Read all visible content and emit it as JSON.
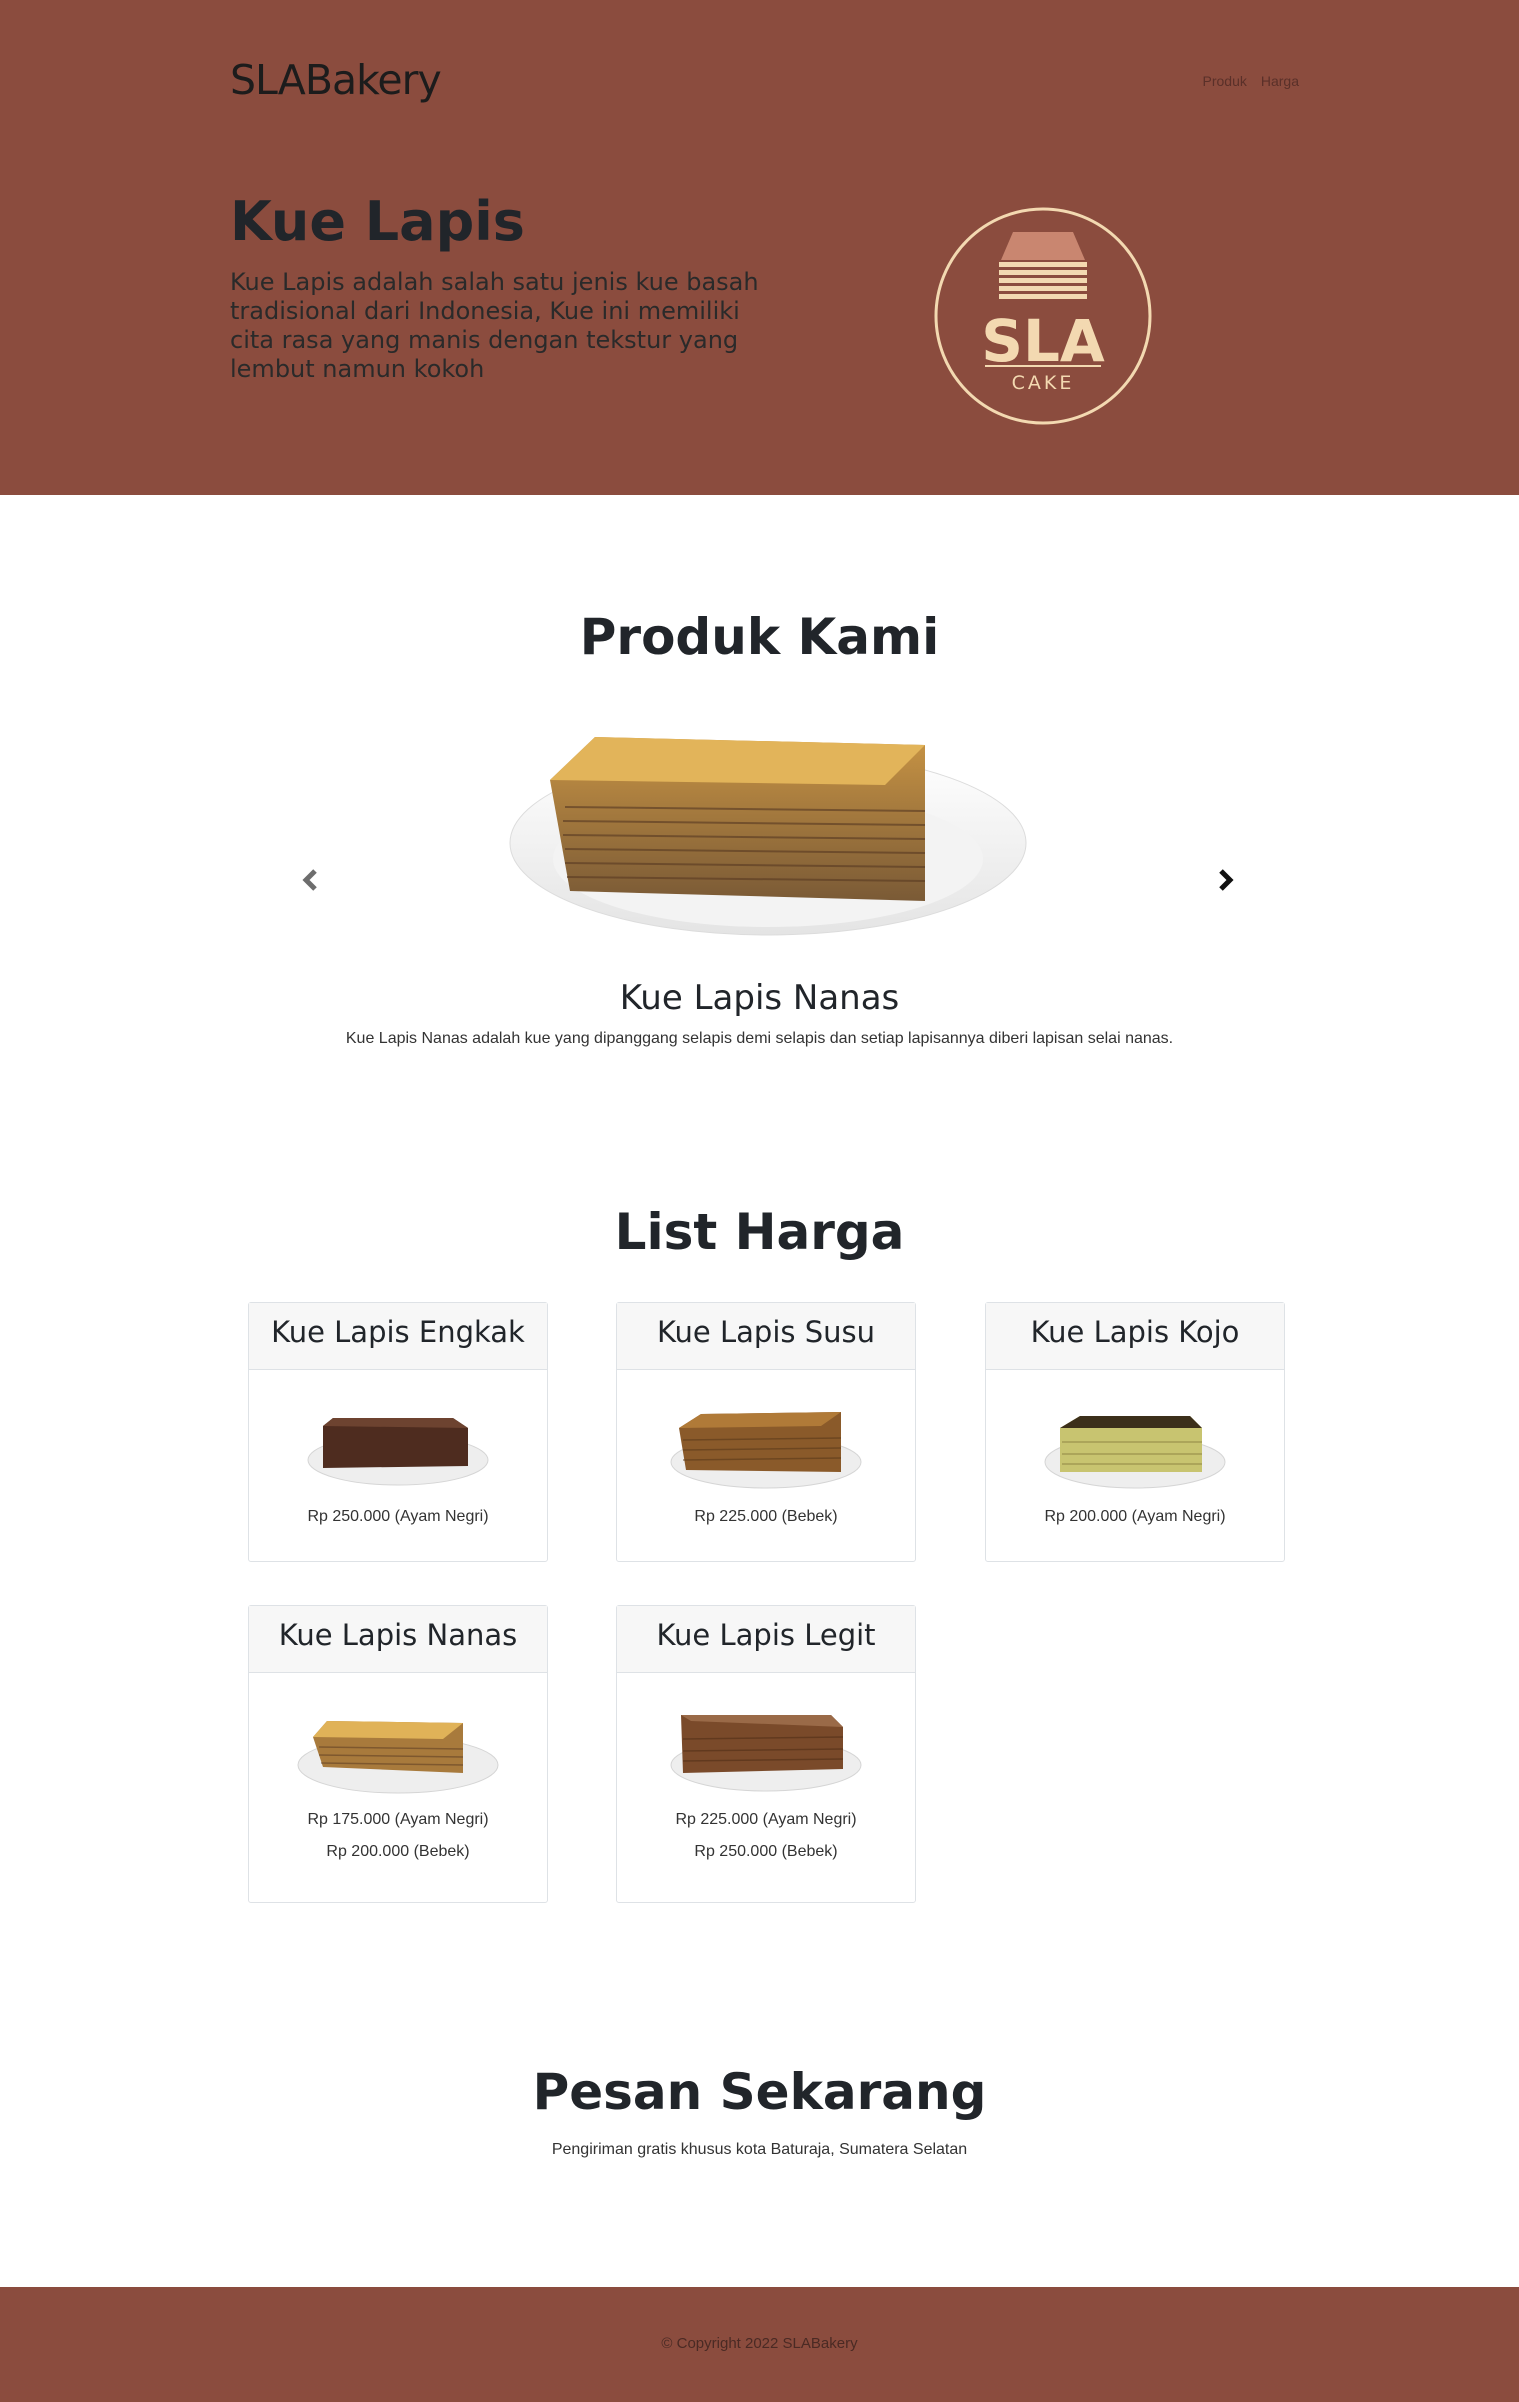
{
  "header": {
    "brand": "SLABakery",
    "nav": [
      "Produk",
      "Harga"
    ]
  },
  "hero": {
    "title": "Kue Lapis",
    "description": "Kue Lapis adalah salah satu jenis kue basah tradisional dari Indonesia, Kue ini memiliki cita rasa yang manis dengan tekstur yang lembut namun kokoh",
    "logo": {
      "word": "SLA",
      "sub": "CAKE"
    }
  },
  "products": {
    "title": "Produk Kami",
    "slide": {
      "name": "Kue Lapis Nanas",
      "description": "Kue Lapis Nanas adalah kue yang dipanggang selapis demi selapis dan setiap lapisannya diberi lapisan selai nanas."
    }
  },
  "prices": {
    "title": "List Harga",
    "items": [
      {
        "name": "Kue Lapis Engkak",
        "prices": [
          "Rp 250.000 (Ayam Negri)"
        ]
      },
      {
        "name": "Kue Lapis Susu",
        "prices": [
          "Rp 225.000 (Bebek)"
        ]
      },
      {
        "name": "Kue Lapis Kojo",
        "prices": [
          "Rp 200.000 (Ayam Negri)"
        ]
      },
      {
        "name": "Kue Lapis Nanas",
        "prices": [
          "Rp 175.000 (Ayam Negri)",
          "Rp 200.000 (Bebek)"
        ]
      },
      {
        "name": "Kue Lapis Legit",
        "prices": [
          "Rp 225.000 (Ayam Negri)",
          "Rp 250.000 (Bebek)"
        ]
      }
    ]
  },
  "order": {
    "title": "Pesan Sekarang",
    "text": "Pengiriman gratis khusus kota Baturaja, Sumatera Selatan"
  },
  "footer": {
    "copyright": "© Copyright 2022 SLABakery"
  },
  "colors": {
    "brown": "#8b4c3e",
    "cream": "#f3d9b1"
  }
}
